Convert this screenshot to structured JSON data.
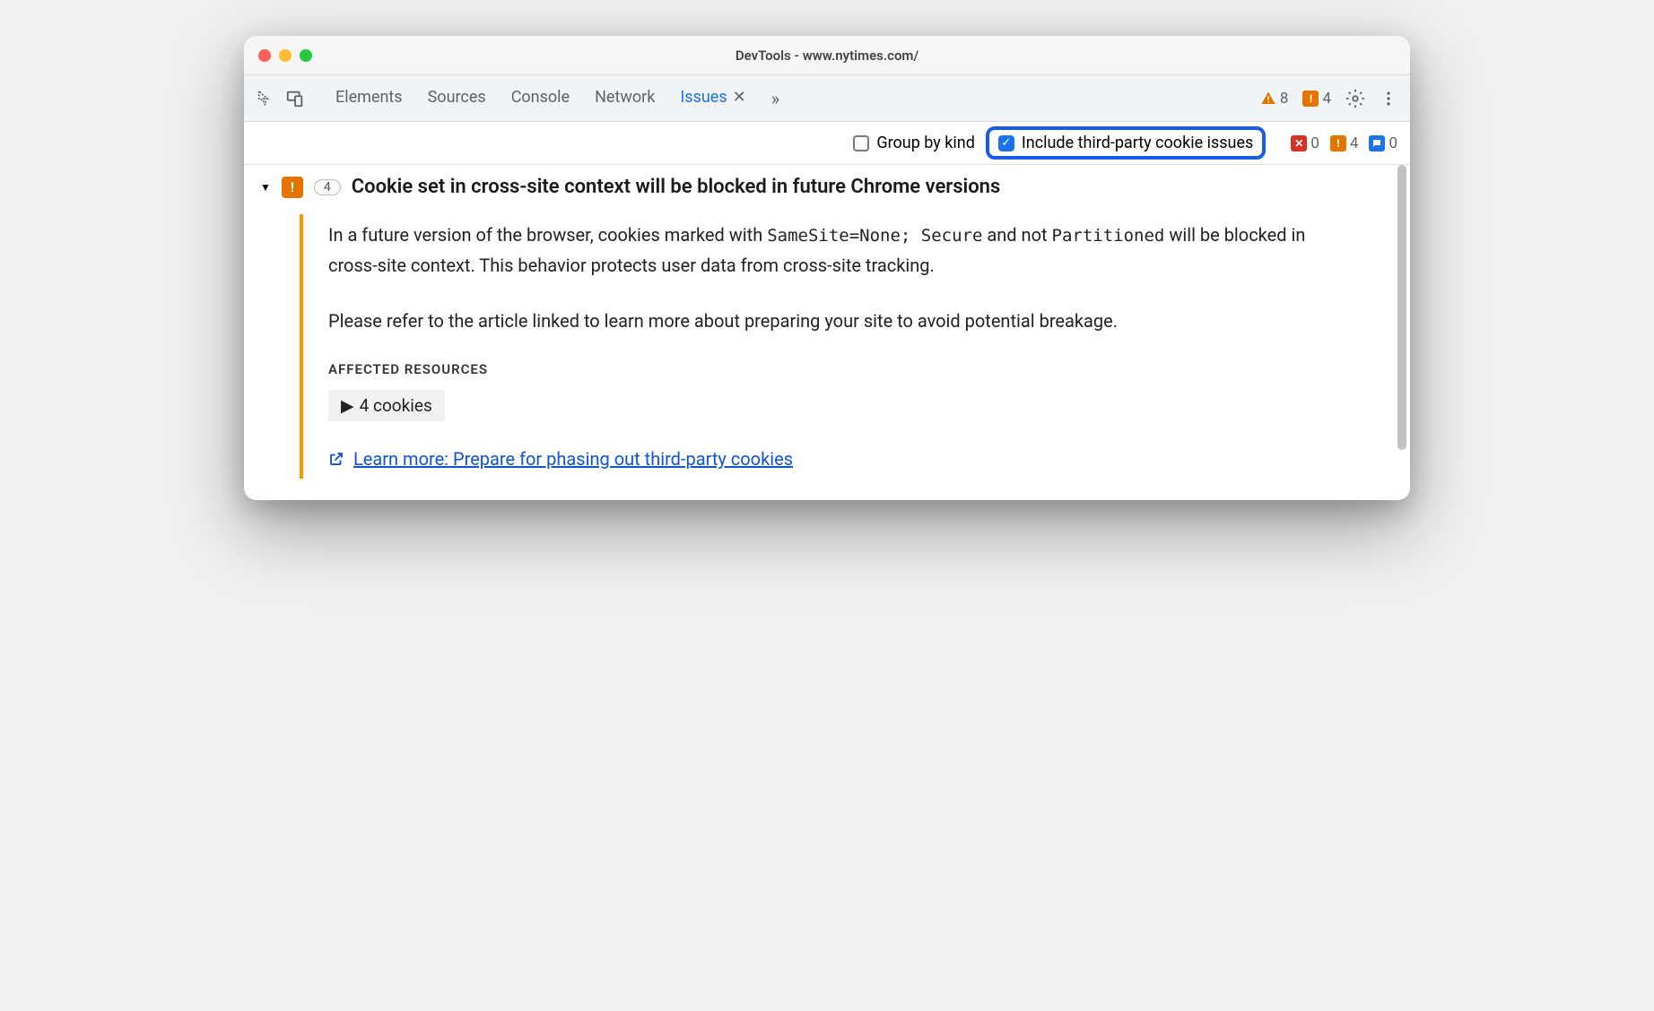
{
  "window": {
    "title": "DevTools - www.nytimes.com/"
  },
  "tabs": {
    "elements": "Elements",
    "sources": "Sources",
    "console": "Console",
    "network": "Network",
    "issues": "Issues"
  },
  "toolbar_counts": {
    "warnings": "8",
    "errors": "4"
  },
  "filter": {
    "group_by_kind": "Group by kind",
    "include_third": "Include third-party cookie issues"
  },
  "filter_counts": {
    "red": "0",
    "orange": "4",
    "blue": "0"
  },
  "issue": {
    "count": "4",
    "title": "Cookie set in cross-site context will be blocked in future Chrome versions",
    "desc_p1_a": "In a future version of the browser, cookies marked with ",
    "desc_p1_code1": "SameSite=None; Secure",
    "desc_p1_b": " and not ",
    "desc_p1_code2": "Partitioned",
    "desc_p1_c": " will be blocked in cross-site context. This behavior protects user data from cross-site tracking.",
    "desc_p2": "Please refer to the article linked to learn more about preparing your site to avoid potential breakage.",
    "affected_header": "AFFECTED RESOURCES",
    "affected_item": "4 cookies",
    "learn_more": "Learn more: Prepare for phasing out third-party cookies"
  }
}
